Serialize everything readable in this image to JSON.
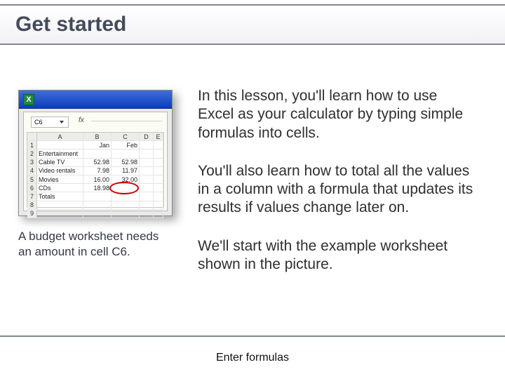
{
  "title": "Get started",
  "left": {
    "excel": {
      "app_icon_letter": "X",
      "namebox": "C6",
      "fx_label": "fx",
      "headers": [
        "",
        "A",
        "B",
        "C",
        "D",
        "E"
      ],
      "rows": [
        {
          "n": "1",
          "a": "",
          "b": "Jan",
          "c": "Feb",
          "d": "",
          "e": ""
        },
        {
          "n": "2",
          "a": "Entertainment",
          "b": "",
          "c": "",
          "d": "",
          "e": ""
        },
        {
          "n": "3",
          "a": "Cable TV",
          "b": "52.98",
          "c": "52.98",
          "d": "",
          "e": ""
        },
        {
          "n": "4",
          "a": "Video rentals",
          "b": "7.98",
          "c": "11.97",
          "d": "",
          "e": ""
        },
        {
          "n": "5",
          "a": "Movies",
          "b": "16.00",
          "c": "32.00",
          "d": "",
          "e": ""
        },
        {
          "n": "6",
          "a": "CDs",
          "b": "18.98",
          "c": "",
          "d": "",
          "e": ""
        },
        {
          "n": "7",
          "a": "Totals",
          "b": "",
          "c": "",
          "d": "",
          "e": ""
        },
        {
          "n": "8",
          "a": "",
          "b": "",
          "c": "",
          "d": "",
          "e": ""
        },
        {
          "n": "9",
          "a": "",
          "b": "",
          "c": "",
          "d": "",
          "e": ""
        }
      ]
    },
    "caption": "A budget worksheet needs an amount in cell C6."
  },
  "right": {
    "p1": "In this lesson, you'll learn how to use Excel as your calculator by typing simple formulas into cells.",
    "p2": "You'll also learn how to total all the values in a column with a formula that updates its results if values change later on.",
    "p3": "We'll start with the example worksheet shown in the picture."
  },
  "footer": "Enter formulas"
}
